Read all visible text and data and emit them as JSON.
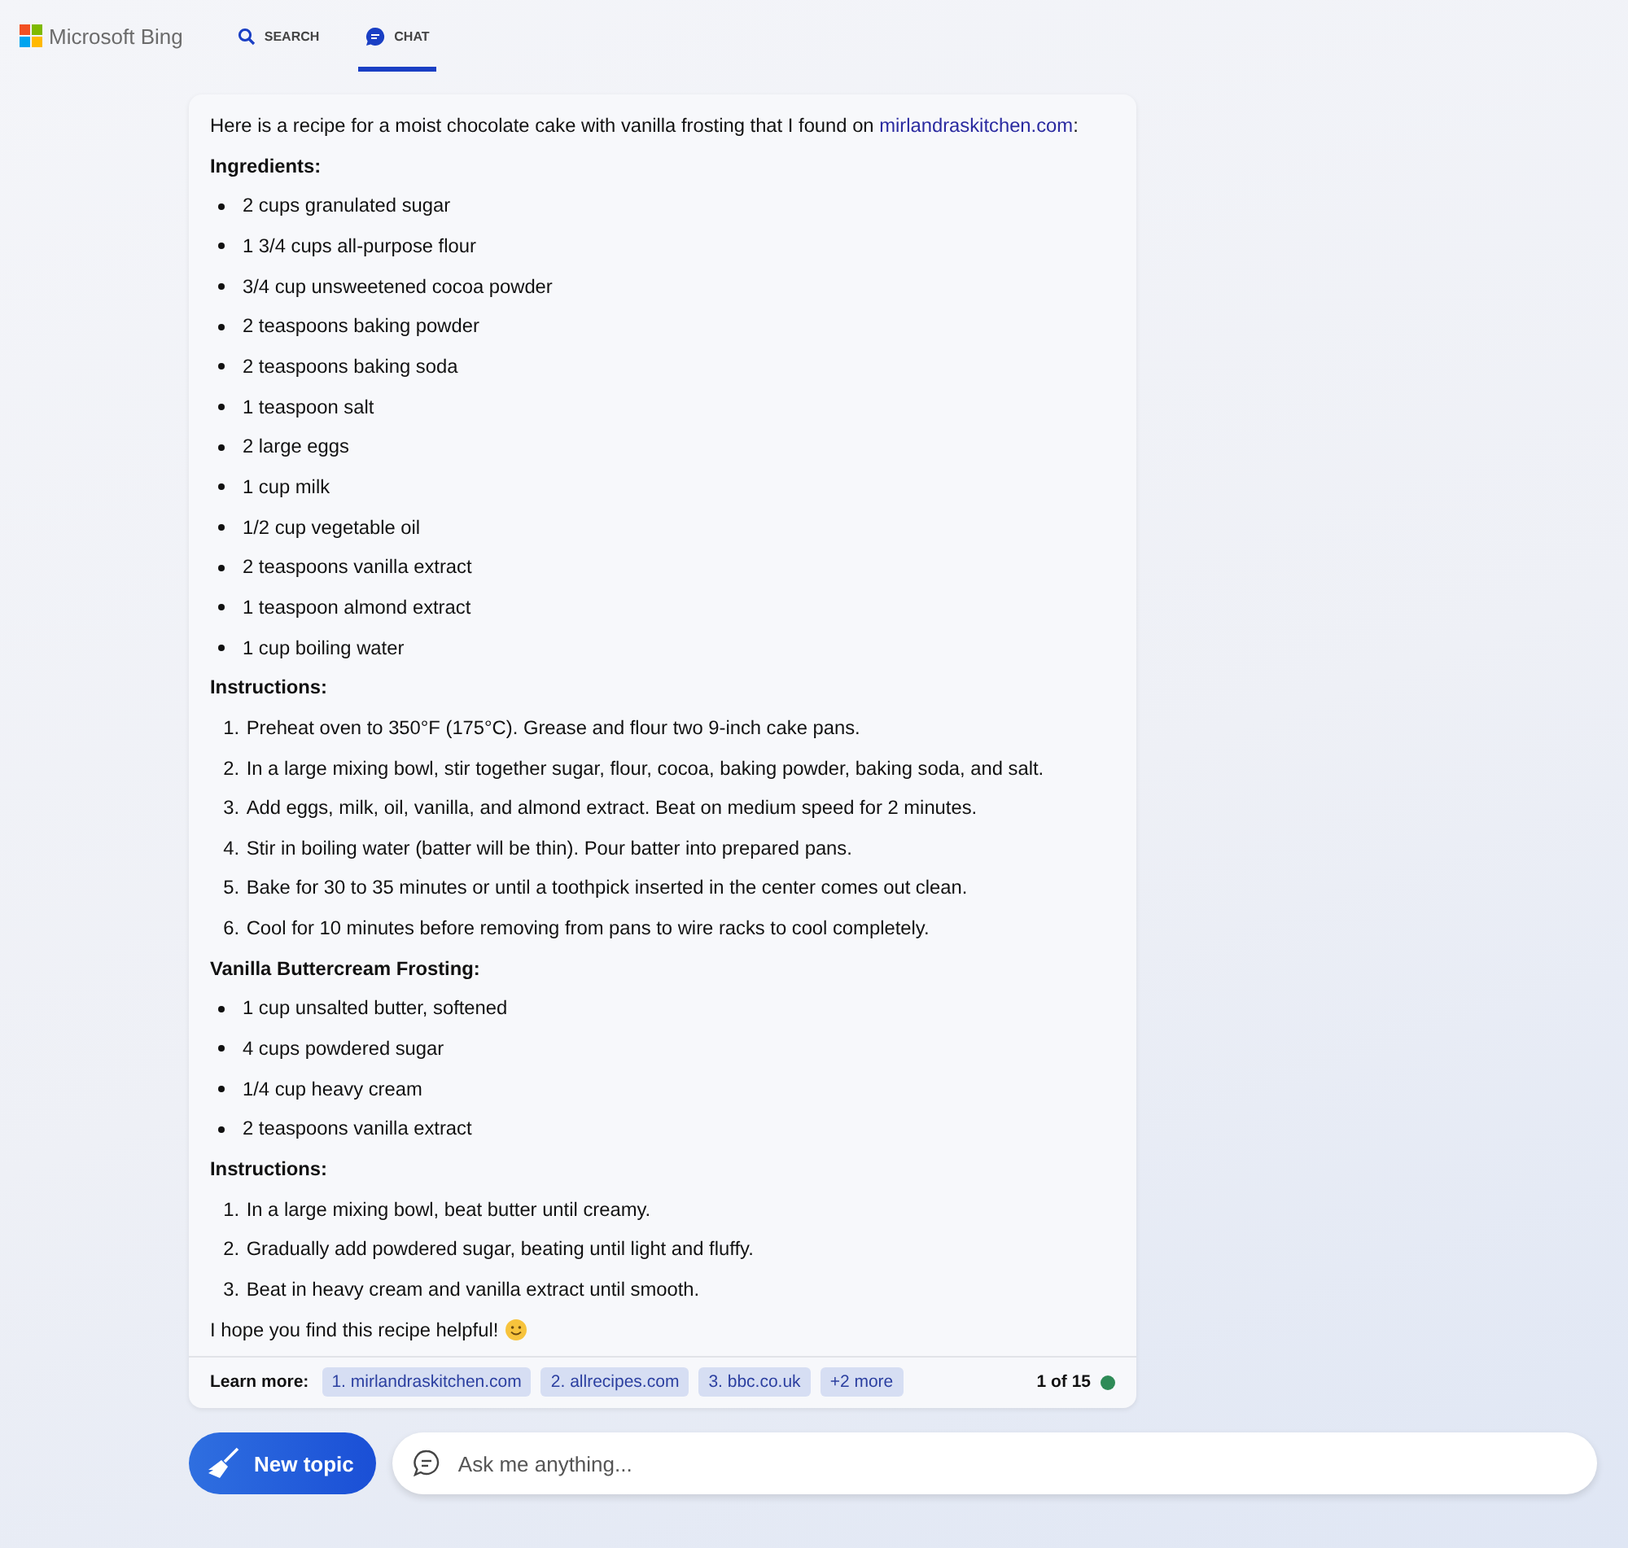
{
  "header": {
    "brand": "Microsoft Bing",
    "tabs": [
      {
        "label": "SEARCH",
        "kind": "search",
        "selected": false
      },
      {
        "label": "CHAT",
        "kind": "chat",
        "selected": true
      }
    ]
  },
  "message": {
    "intro": "Here is a recipe for a moist chocolate cake with vanilla frosting that I found on",
    "link": "mirlandraskitchen.com",
    "intro_end": ":",
    "blocks": [
      {
        "kind": "heading",
        "text": "Ingredients:"
      },
      {
        "kind": "bullets",
        "items": [
          "2 cups granulated sugar",
          "1 3/4 cups all-purpose flour",
          "3/4 cup unsweetened cocoa powder",
          "2 teaspoons baking powder",
          "2 teaspoons baking soda",
          "1 teaspoon salt",
          "2 large eggs",
          "1 cup milk",
          "1/2 cup vegetable oil",
          "2 teaspoons vanilla extract",
          "1 teaspoon almond extract",
          "1 cup boiling water"
        ]
      },
      {
        "kind": "heading",
        "text": "Instructions:"
      },
      {
        "kind": "numbered",
        "items": [
          {
            "number": "1.",
            "text": "Preheat oven to 350°F (175°C). Grease and flour two 9-inch cake pans."
          },
          {
            "number": "2.",
            "text": "In a large mixing bowl, stir together sugar, flour, cocoa, baking powder, baking soda, and salt."
          },
          {
            "number": "3.",
            "text": "Add eggs, milk, oil, vanilla, and almond extract. Beat on medium speed for 2 minutes."
          },
          {
            "number": "4.",
            "text": "Stir in boiling water (batter will be thin). Pour batter into prepared pans."
          },
          {
            "number": "5.",
            "text": "Bake for 30 to 35 minutes or until a toothpick inserted in the center comes out clean."
          },
          {
            "number": "6.",
            "text": "Cool for 10 minutes before removing from pans to wire racks to cool completely."
          }
        ]
      },
      {
        "kind": "heading",
        "text": "Vanilla Buttercream Frosting:"
      },
      {
        "kind": "bullets",
        "items": [
          "1 cup unsalted butter, softened",
          "4 cups powdered sugar",
          "1/4 cup heavy cream",
          "2 teaspoons vanilla extract"
        ]
      },
      {
        "kind": "heading",
        "text": "Instructions:"
      },
      {
        "kind": "numbered",
        "items": [
          {
            "number": "1.",
            "text": "In a large mixing bowl, beat butter until creamy."
          },
          {
            "number": "2.",
            "text": "Gradually add powdered sugar, beating until light and fluffy."
          },
          {
            "number": "3.",
            "text": "Beat in heavy cream and vanilla extract until smooth."
          }
        ]
      }
    ],
    "closing": "I hope you find this recipe helpful!",
    "learn_more": {
      "label": "Learn more:",
      "sources": [
        "1. mirlandraskitchen.com",
        "2. allrecipes.com",
        "3. bbc.co.uk",
        "+2 more"
      ]
    },
    "counter": {
      "text": "1 of 15",
      "color": "#2e8b57"
    }
  },
  "composer": {
    "new_topic": "New topic",
    "placeholder": "Ask me anything..."
  }
}
